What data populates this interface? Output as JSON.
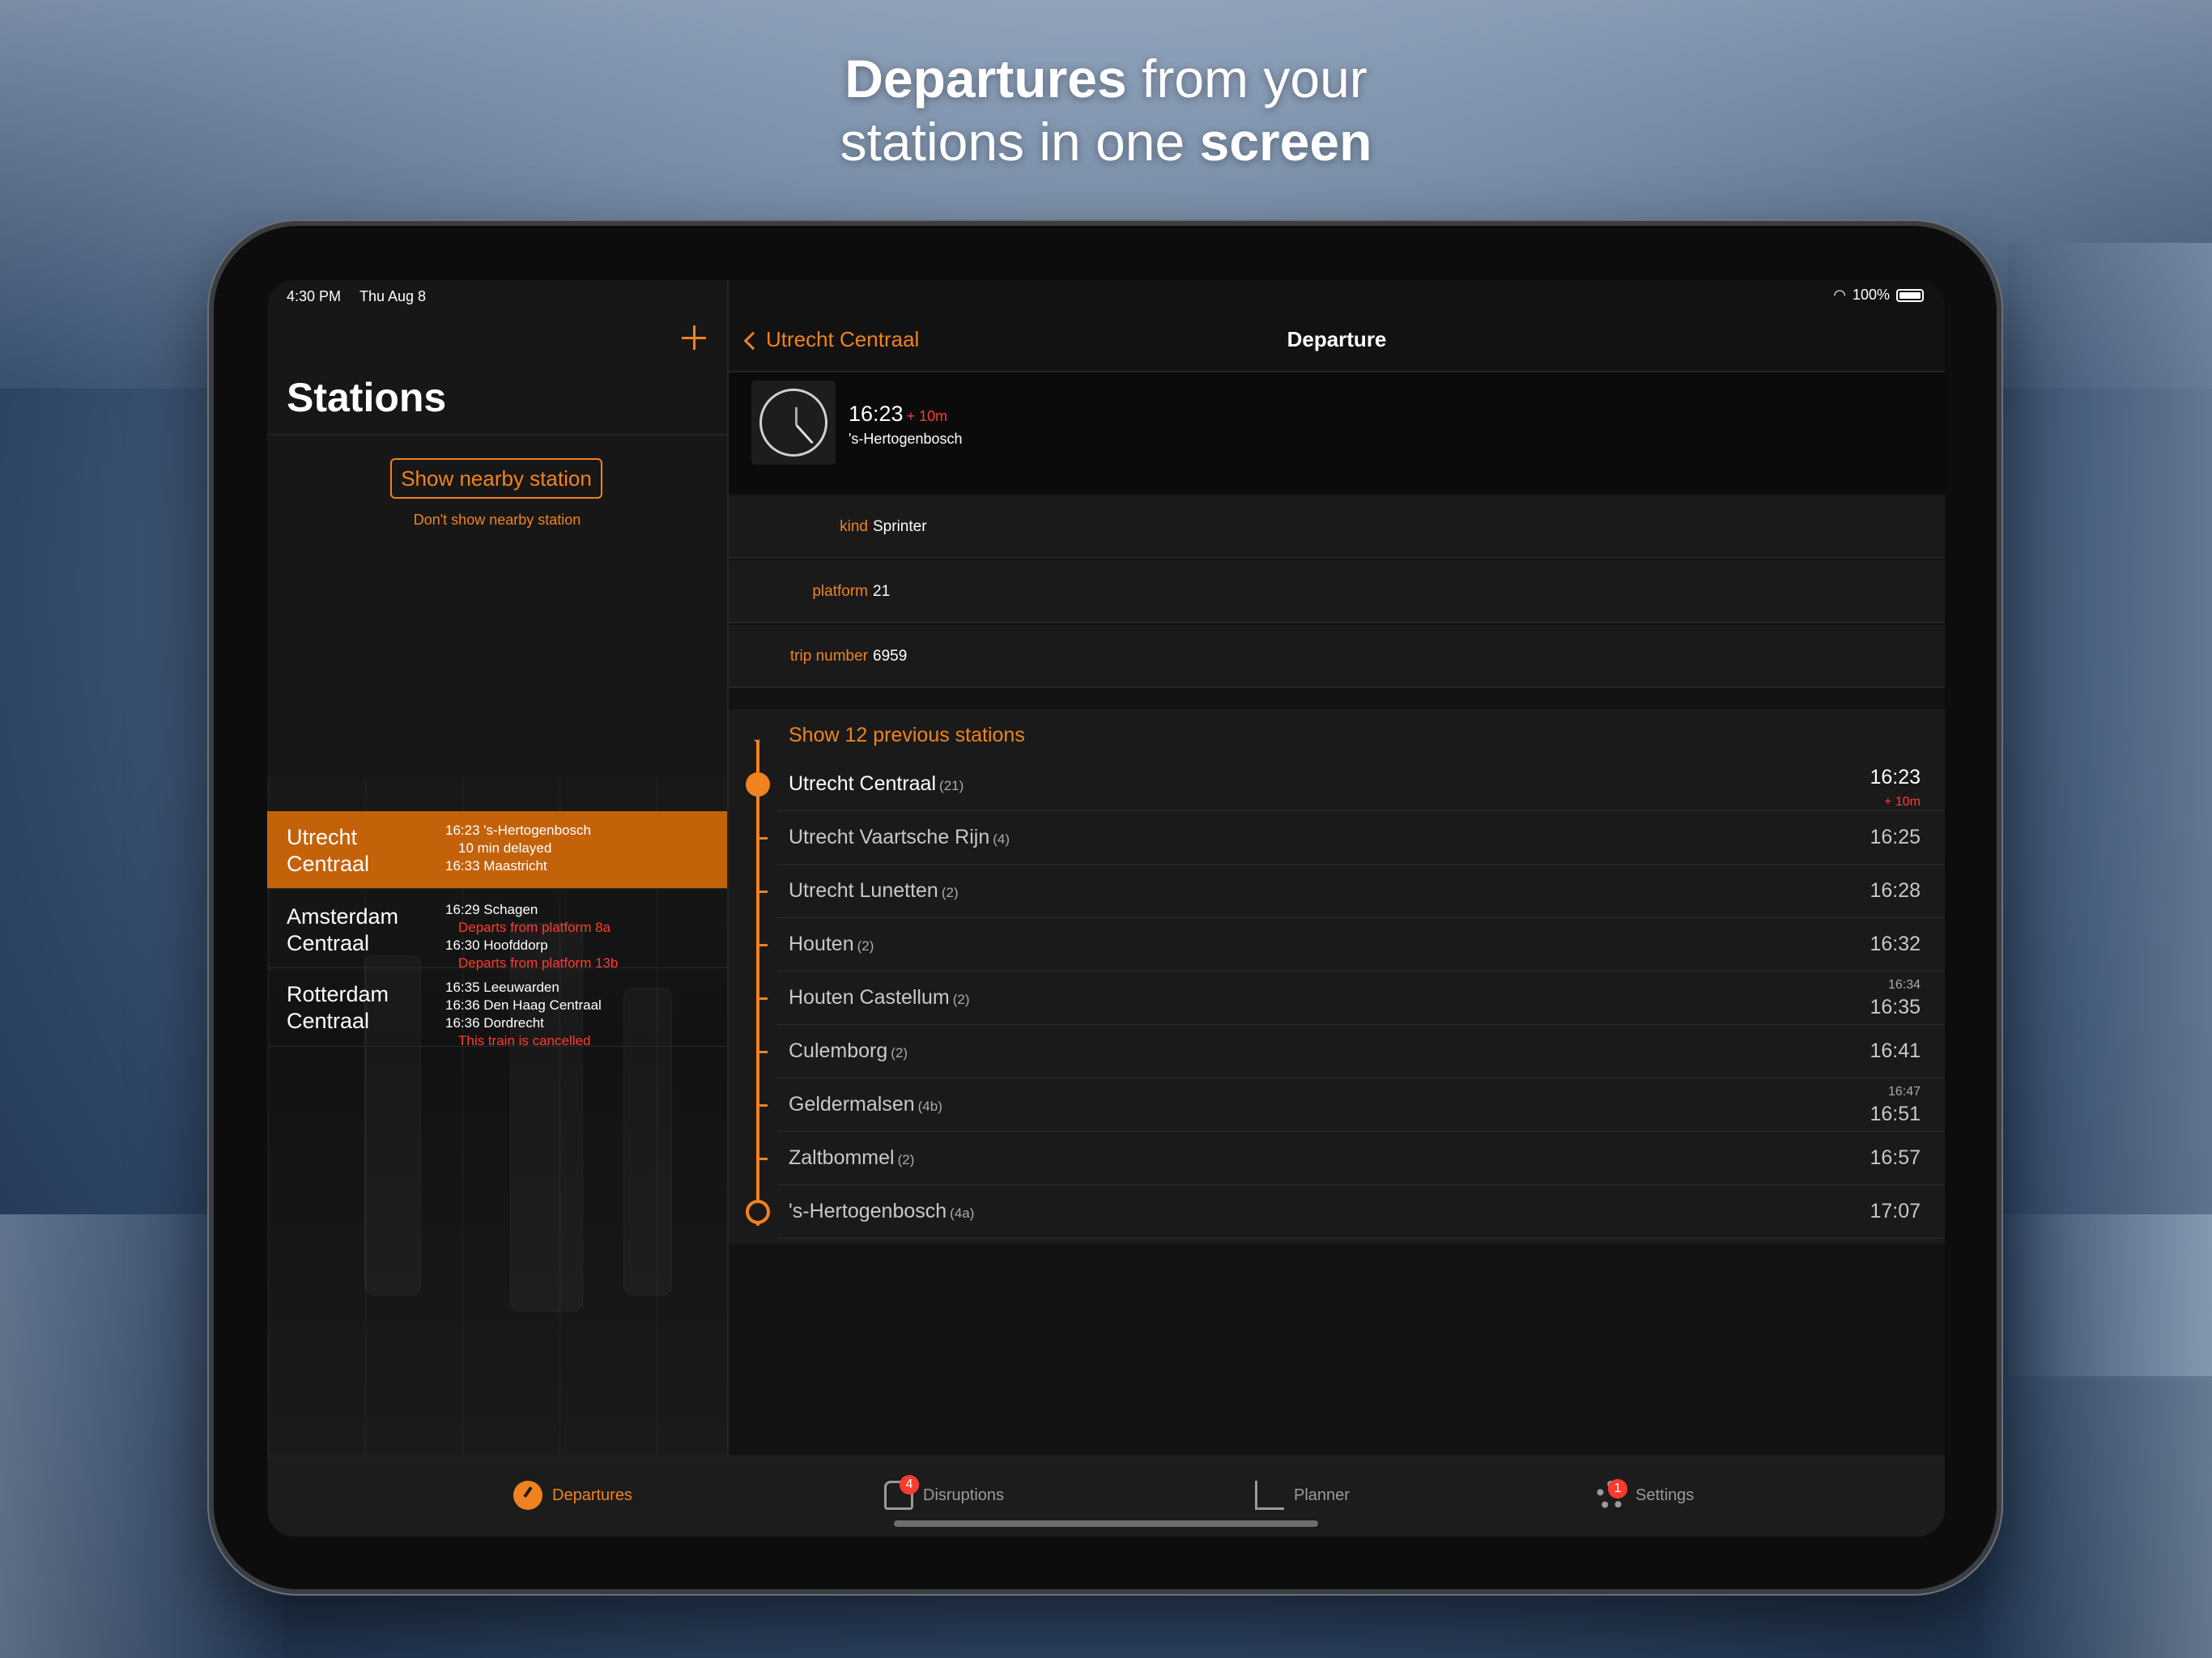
{
  "headline": {
    "line1_bold": "Departures",
    "line1_rest": "from your",
    "line2_start": "stations in one",
    "line2_bold": "screen"
  },
  "status_bar": {
    "time": "4:30 PM",
    "date": "Thu Aug 8",
    "battery": "100%"
  },
  "master": {
    "title": "Stations",
    "nearby_button": "Show nearby station",
    "dont_show": "Don't show nearby station",
    "stations": [
      {
        "name": "Utrecht Centraal",
        "active": true,
        "departures": [
          {
            "text": "16:23 's-Hertogenbosch",
            "note": "10 min delayed",
            "note_style": "sub"
          },
          {
            "text": "16:33 Maastricht",
            "note": "",
            "note_style": ""
          }
        ]
      },
      {
        "name": "Amsterdam Centraal",
        "active": false,
        "departures": [
          {
            "text": "16:29 Schagen",
            "note": "Departs from platform 8a",
            "note_style": "red"
          },
          {
            "text": "16:30 Hoofddorp",
            "note": "Departs from platform 13b",
            "note_style": "red"
          }
        ]
      },
      {
        "name": "Rotterdam Centraal",
        "active": false,
        "departures": [
          {
            "text": "16:35 Leeuwarden",
            "note": "",
            "note_style": ""
          },
          {
            "text": "16:36 Den Haag Centraal",
            "note": "",
            "note_style": ""
          },
          {
            "text": "16:36 Dordrecht",
            "note": "This train is cancelled",
            "note_style": "red"
          }
        ]
      }
    ]
  },
  "detail": {
    "back_label": "Utrecht Centraal",
    "title": "Departure",
    "header": {
      "time": "16:23",
      "delay": "+ 10m",
      "destination": "'s-Hertogenbosch"
    },
    "info": [
      {
        "label": "kind",
        "value": "Sprinter"
      },
      {
        "label": "platform",
        "value": "21"
      },
      {
        "label": "trip number",
        "value": "6959"
      }
    ],
    "show_previous": "Show 12 previous stations",
    "stops": [
      {
        "name": "Utrecht Centraal",
        "platform": "(21)",
        "time": "16:23",
        "delay": "+ 10m",
        "scheduled": ""
      },
      {
        "name": "Utrecht Vaartsche Rijn",
        "platform": "(4)",
        "time": "16:25",
        "delay": "",
        "scheduled": ""
      },
      {
        "name": "Utrecht Lunetten",
        "platform": "(2)",
        "time": "16:28",
        "delay": "",
        "scheduled": ""
      },
      {
        "name": "Houten",
        "platform": "(2)",
        "time": "16:32",
        "delay": "",
        "scheduled": ""
      },
      {
        "name": "Houten Castellum",
        "platform": "(2)",
        "time": "16:35",
        "delay": "",
        "scheduled": "16:34"
      },
      {
        "name": "Culemborg",
        "platform": "(2)",
        "time": "16:41",
        "delay": "",
        "scheduled": ""
      },
      {
        "name": "Geldermalsen",
        "platform": "(4b)",
        "time": "16:51",
        "delay": "",
        "scheduled": "16:47"
      },
      {
        "name": "Zaltbommel",
        "platform": "(2)",
        "time": "16:57",
        "delay": "",
        "scheduled": ""
      },
      {
        "name": "'s-Hertogenbosch",
        "platform": "(4a)",
        "time": "17:07",
        "delay": "",
        "scheduled": ""
      }
    ]
  },
  "tabbar": {
    "tabs": [
      {
        "label": "Departures",
        "icon": "departures-icon",
        "badge": "",
        "active": true
      },
      {
        "label": "Disruptions",
        "icon": "disruptions-icon",
        "badge": "4",
        "active": false
      },
      {
        "label": "Planner",
        "icon": "planner-icon",
        "badge": "",
        "active": false
      },
      {
        "label": "Settings",
        "icon": "settings-icon",
        "badge": "1",
        "active": false
      }
    ]
  },
  "colors": {
    "accent": "#f0831f",
    "active_row": "#c4620a",
    "alert": "#ff3b30"
  }
}
